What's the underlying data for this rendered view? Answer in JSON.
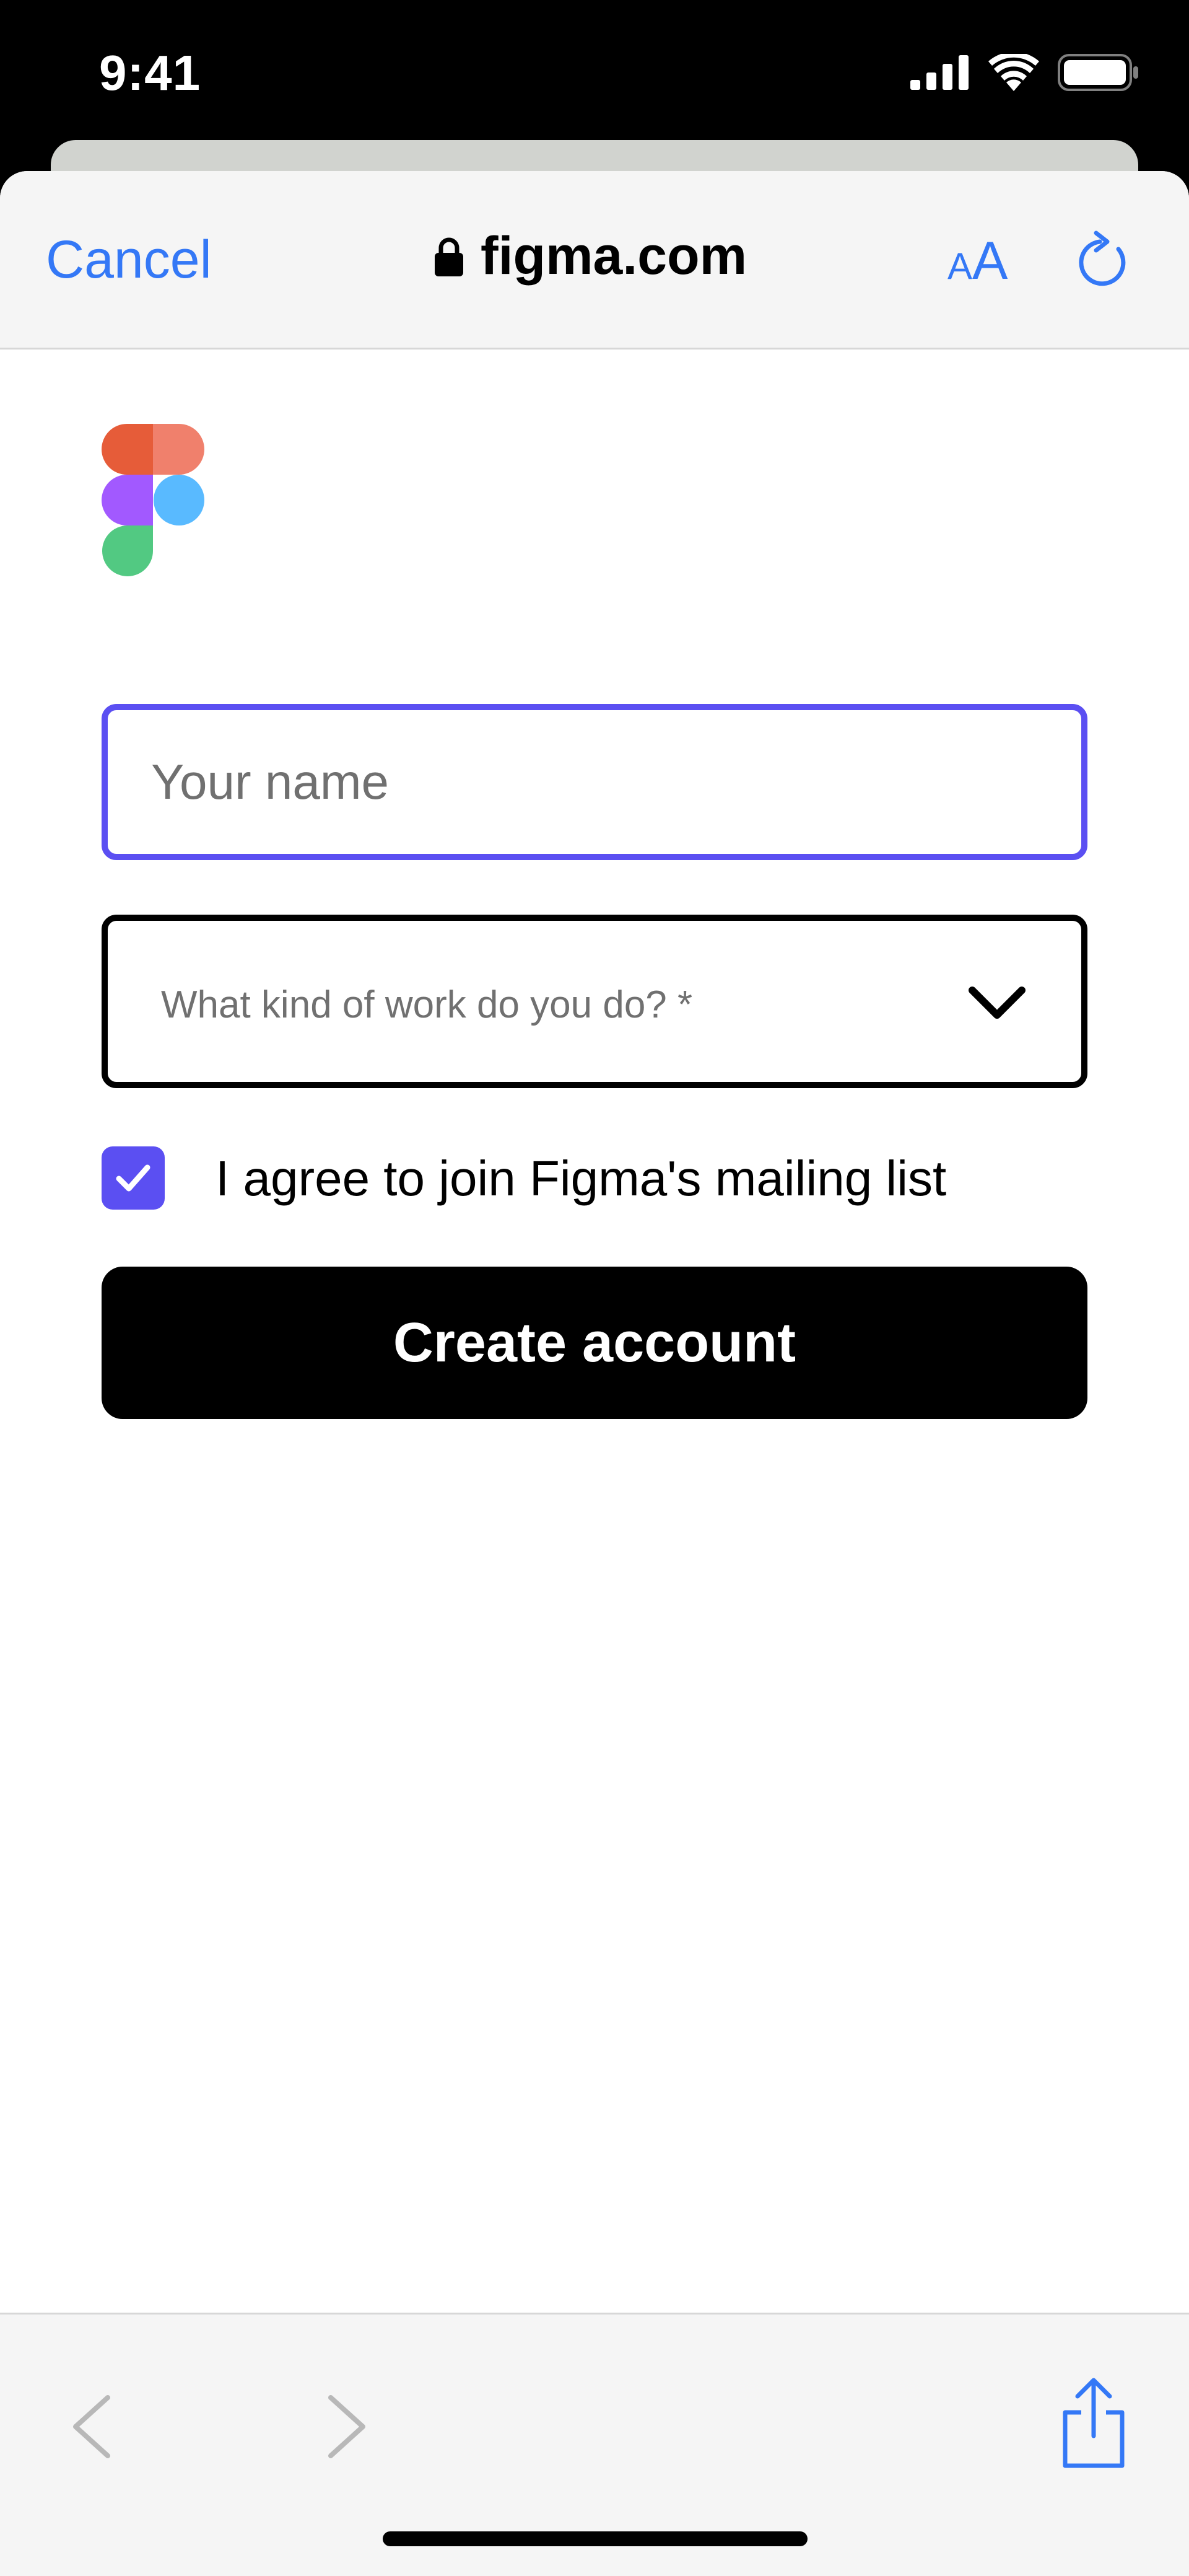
{
  "status_bar": {
    "time": "9:41"
  },
  "browser": {
    "cancel_label": "Cancel",
    "url": "figma.com",
    "text_size_small": "A",
    "text_size_large": "A",
    "accent_color": "#3478f6"
  },
  "form": {
    "name_placeholder": "Your name",
    "work_placeholder": "What kind of work do you do? *",
    "mailing_list_label": "I agree to join Figma's mailing list",
    "mailing_list_checked": true,
    "submit_label": "Create account",
    "focus_color": "#5b4ff2"
  },
  "toolbar": {
    "icons": [
      "chevron-left-icon",
      "chevron-right-icon",
      "share-icon"
    ]
  }
}
